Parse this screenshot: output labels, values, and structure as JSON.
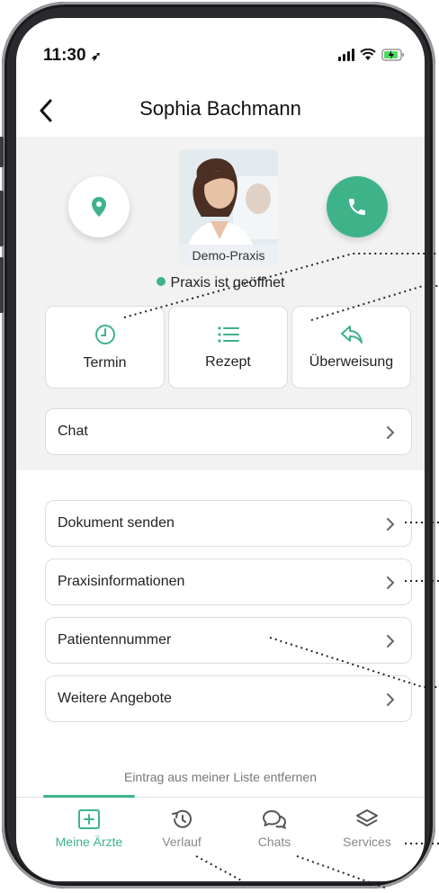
{
  "status_bar": {
    "time": "11:30"
  },
  "header": {
    "title": "Sophia Bachmann"
  },
  "practice": {
    "photo_label": "Demo-Praxis",
    "status_text": "Praxis ist geöffnet",
    "status_color": "#3eb389"
  },
  "actions": [
    {
      "label": "Termin",
      "icon": "clock-icon"
    },
    {
      "label": "Rezept",
      "icon": "list-icon"
    },
    {
      "label": "Überweisung",
      "icon": "reply-arrow-icon"
    }
  ],
  "chat": {
    "label": "Chat"
  },
  "menu": [
    {
      "label": "Dokument senden"
    },
    {
      "label": "Praxisinformationen"
    },
    {
      "label": "Patientennummer"
    },
    {
      "label": "Weitere Angebote"
    }
  ],
  "remove_link": "Eintrag aus meiner Liste entfernen",
  "tabs": [
    {
      "label": "Meine Ärzte",
      "icon": "plus-square-icon",
      "active": true
    },
    {
      "label": "Verlauf",
      "icon": "history-icon",
      "active": false
    },
    {
      "label": "Chats",
      "icon": "chat-bubbles-icon",
      "active": false
    },
    {
      "label": "Services",
      "icon": "layers-icon",
      "active": false
    }
  ],
  "colors": {
    "accent": "#3eb389",
    "background": "#f2f2f2"
  }
}
